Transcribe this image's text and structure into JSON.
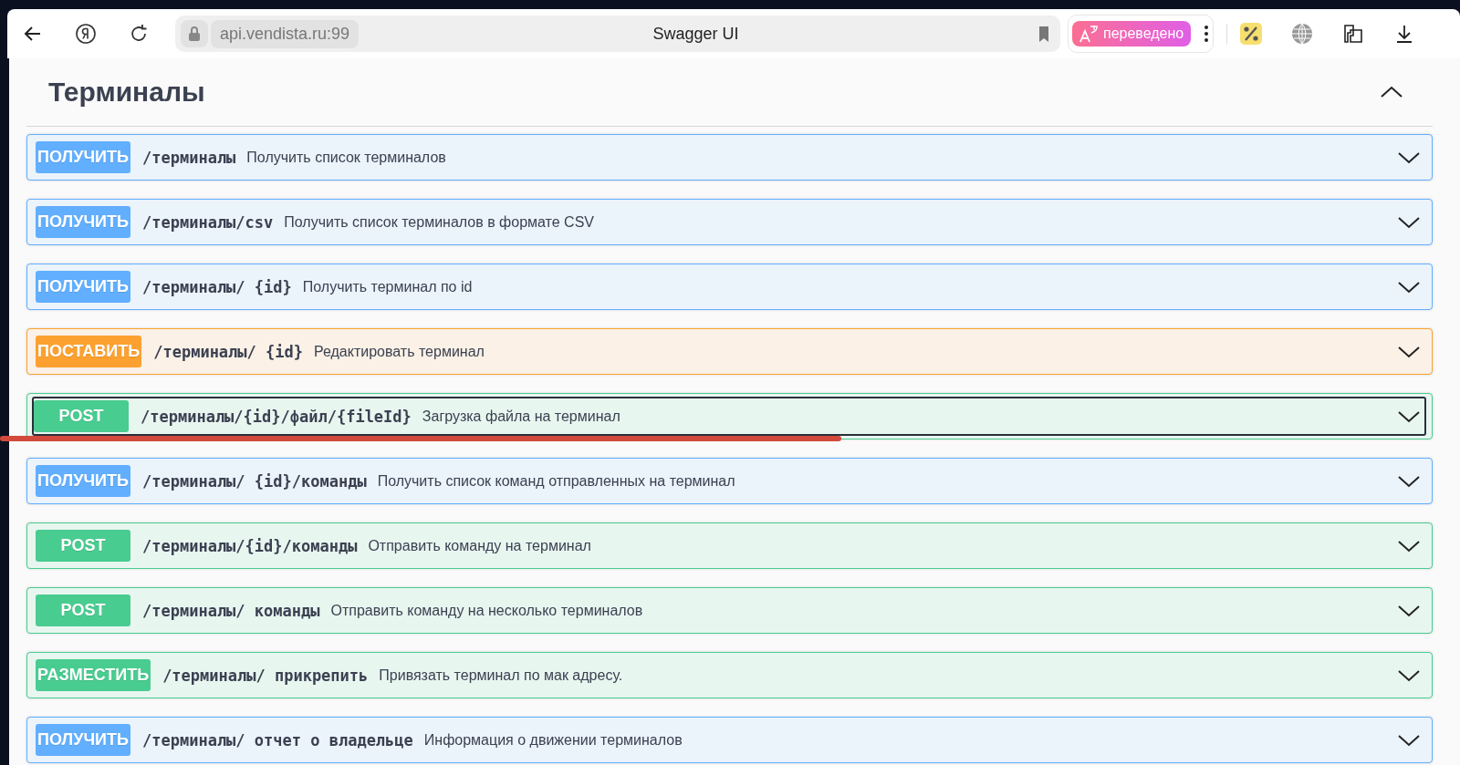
{
  "browser": {
    "address": "api.vendista.ru:99",
    "page_title": "Swagger UI",
    "translate_badge": "переведено"
  },
  "section": {
    "title": "Терминалы",
    "expanded": true
  },
  "operations": [
    {
      "kind": "get",
      "method": "ПОЛУЧИТЬ",
      "path": "/терминалы",
      "summary": "Получить список терминалов",
      "focused": false,
      "underlined": false
    },
    {
      "kind": "get",
      "method": "ПОЛУЧИТЬ",
      "path": "/терминалы/csv",
      "summary": "Получить список терминалов в формате CSV",
      "focused": false,
      "underlined": false
    },
    {
      "kind": "get",
      "method": "ПОЛУЧИТЬ",
      "path": "/терминалы/ {id}",
      "summary": "Получить терминал по id",
      "focused": false,
      "underlined": false
    },
    {
      "kind": "put",
      "method": "ПОСТАВИТЬ",
      "path": "/терминалы/ {id}",
      "summary": "Редактировать терминал",
      "focused": false,
      "underlined": false
    },
    {
      "kind": "post",
      "method": "POST",
      "path": "/терминалы/{id}/файл/{fileId}",
      "summary": "Загрузка файла на терминал",
      "focused": true,
      "underlined": true
    },
    {
      "kind": "get",
      "method": "ПОЛУЧИТЬ",
      "path": "/терминалы/ {id}/команды",
      "summary": "Получить список команд отправленных на терминал",
      "focused": false,
      "underlined": false
    },
    {
      "kind": "post",
      "method": "POST",
      "path": "/терминалы/{id}/команды",
      "summary": "Отправить команду на терминал",
      "focused": false,
      "underlined": false
    },
    {
      "kind": "post",
      "method": "POST",
      "path": "/терминалы/ команды",
      "summary": "Отправить команду на несколько терминалов",
      "focused": false,
      "underlined": false
    },
    {
      "kind": "post",
      "method": "РАЗМЕСТИТЬ",
      "path": "/терминалы/ прикрепить",
      "summary": "Привязать терминал по мак адресу.",
      "focused": false,
      "underlined": false
    },
    {
      "kind": "get",
      "method": "ПОЛУЧИТЬ",
      "path": "/терминалы/ отчет о владельце",
      "summary": "Информация о движении терминалов",
      "focused": false,
      "underlined": false
    }
  ]
}
